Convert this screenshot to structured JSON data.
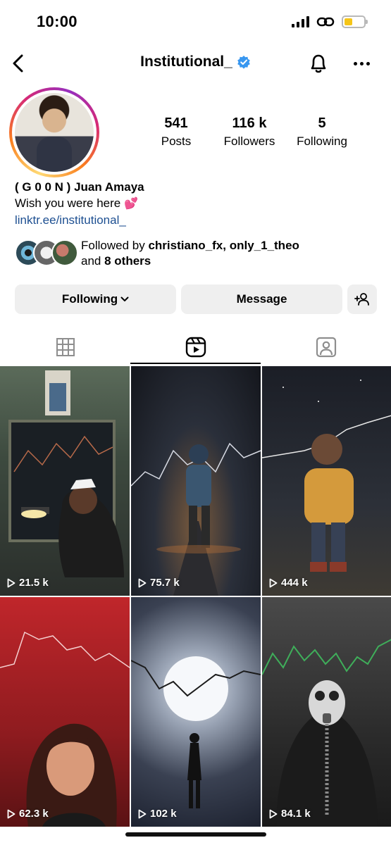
{
  "status_bar": {
    "time": "10:00",
    "battery_color": "#f5c518"
  },
  "nav": {
    "title": "Institutional_",
    "verified_color": "#3897f0"
  },
  "profile": {
    "stats": [
      {
        "value": "541",
        "label": "Posts"
      },
      {
        "value": "116 k",
        "label": "Followers"
      },
      {
        "value": "5",
        "label": "Following"
      }
    ],
    "name": "( G 0 0 N ) Juan Amaya",
    "bio": "Wish you were here",
    "bio_emoji": "💕",
    "link": "linktr.ee/institutional_",
    "followed_by_prefix": "Followed by",
    "followed_by_names": "christiano_fx, only_1_theo",
    "followed_by_and": "and",
    "followed_by_others": "8 others"
  },
  "actions": {
    "following_label": "Following",
    "message_label": "Message"
  },
  "tabs": [
    "grid-icon",
    "reels-icon",
    "tagged-icon"
  ],
  "reels": [
    {
      "views": "21.5 k"
    },
    {
      "views": "75.7 k"
    },
    {
      "views": "444 k"
    },
    {
      "views": "62.3 k"
    },
    {
      "views": "102 k"
    },
    {
      "views": "84.1 k"
    }
  ]
}
